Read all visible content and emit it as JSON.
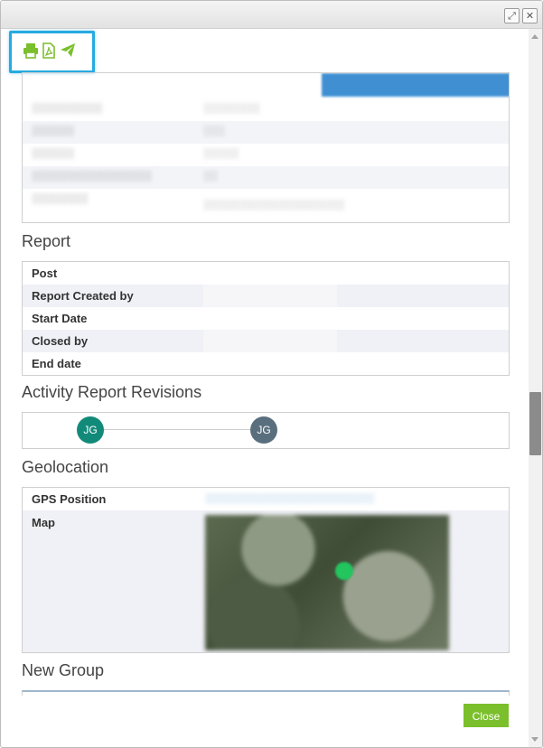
{
  "toolbar": {
    "icons": [
      "printer-icon",
      "pdf-icon",
      "send-icon"
    ],
    "accent": "#7bbf2d",
    "highlight": "#27aae1"
  },
  "report": {
    "title": "Report",
    "rows": [
      {
        "label": "Post",
        "value": ""
      },
      {
        "label": "Report Created by",
        "value": ""
      },
      {
        "label": "Start Date",
        "value": ""
      },
      {
        "label": "Closed by",
        "value": ""
      },
      {
        "label": "End date",
        "value": ""
      }
    ]
  },
  "revisions": {
    "title": "Activity Report Revisions",
    "items": [
      {
        "initials": "JG",
        "color": "#128a7a"
      },
      {
        "initials": "JG",
        "color": "#5a6f7d"
      }
    ]
  },
  "geolocation": {
    "title": "Geolocation",
    "gps_label": "GPS Position",
    "map_label": "Map"
  },
  "new_group": {
    "title": "New Group"
  },
  "close_label": "Close"
}
